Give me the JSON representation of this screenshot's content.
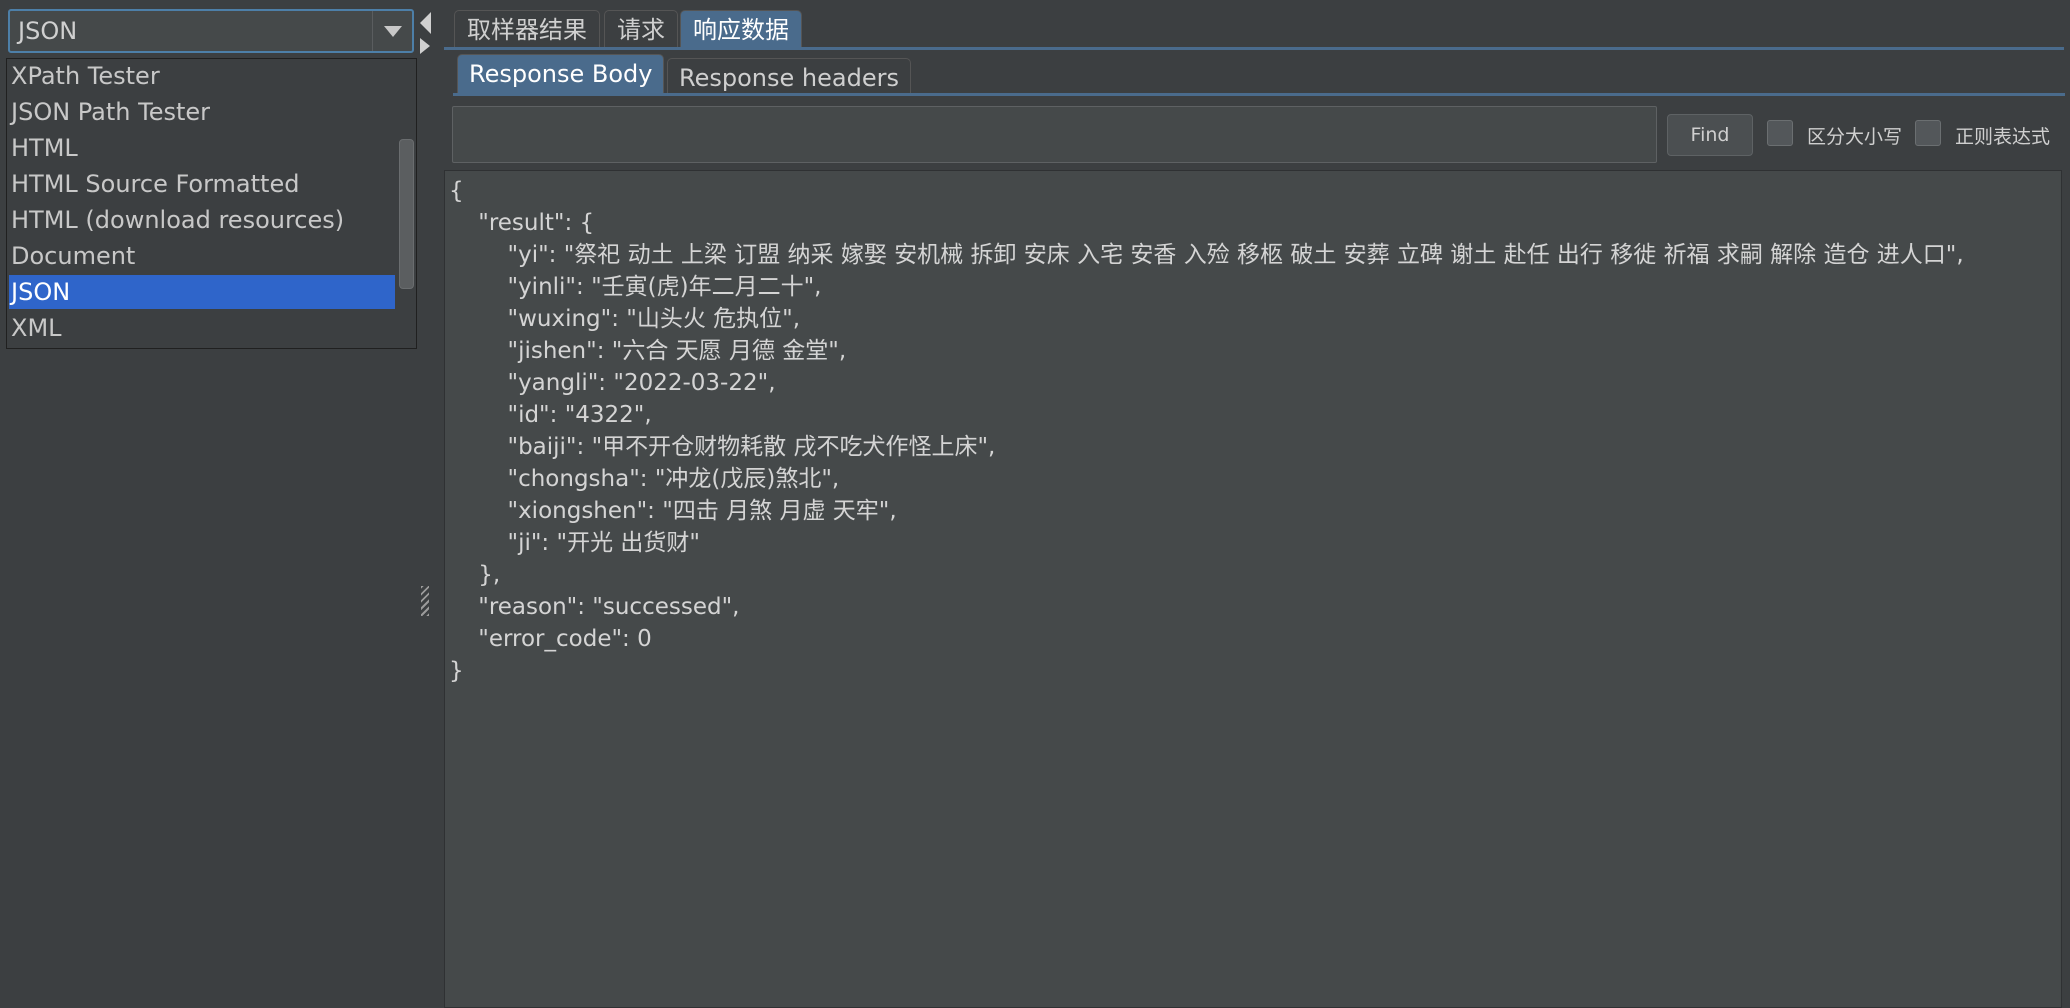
{
  "renderer": {
    "selected": "JSON",
    "options": [
      "XPath Tester",
      "JSON Path Tester",
      "HTML",
      "HTML Source Formatted",
      "HTML (download resources)",
      "Document",
      "JSON",
      "XML"
    ]
  },
  "tabs": [
    "取样器结果",
    "请求",
    "响应数据"
  ],
  "active_tab": "响应数据",
  "subtabs": [
    "Response Body",
    "Response headers"
  ],
  "active_subtab": "Response Body",
  "search": {
    "value": "",
    "placeholder": ""
  },
  "find_label": "Find",
  "case_sensitive_label": "区分大小写",
  "regex_label": "正则表达式",
  "response_lines": [
    "{",
    "    \"result\": {",
    "        \"yi\": \"祭祀 动土 上梁 订盟 纳采 嫁娶 安机械 拆卸 安床 入宅 安香 入殓 移柩 破土 安葬 立碑 谢土 赴任 出行 移徙 祈福 求嗣 解除 造仓 进人口\",",
    "        \"yinli\": \"壬寅(虎)年二月二十\",",
    "        \"wuxing\": \"山头火 危执位\",",
    "        \"jishen\": \"六合 天愿 月德 金堂\",",
    "        \"yangli\": \"2022-03-22\",",
    "        \"id\": \"4322\",",
    "        \"baiji\": \"甲不开仓财物耗散 戌不吃犬作怪上床\",",
    "        \"chongsha\": \"冲龙(戊辰)煞北\",",
    "        \"xiongshen\": \"四击 月煞 月虚 天牢\",",
    "        \"ji\": \"开光 出货财\"",
    "    },",
    "    \"reason\": \"successed\",",
    "    \"error_code\": 0",
    "}"
  ]
}
